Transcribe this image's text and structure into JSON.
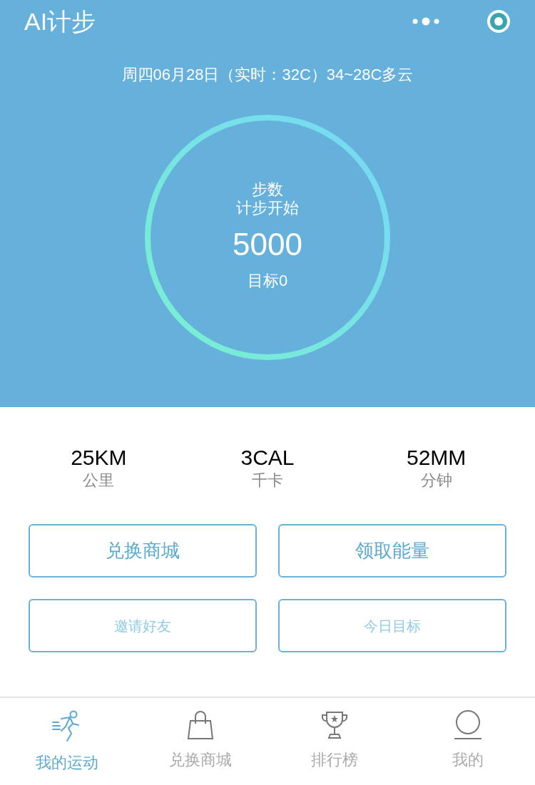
{
  "header": {
    "title": "AI计步",
    "date_weather": "周四06月28日（实时：32C）34~28C多云"
  },
  "ring": {
    "label": "步数",
    "status": "计步开始",
    "steps": "5000",
    "goal": "目标0"
  },
  "stats": [
    {
      "value": "25KM",
      "unit": "公里"
    },
    {
      "value": "3CAL",
      "unit": "千卡"
    },
    {
      "value": "52MM",
      "unit": "分钟"
    }
  ],
  "buttons": [
    {
      "label": "兑换商城",
      "kind": "primary"
    },
    {
      "label": "领取能量",
      "kind": "primary"
    },
    {
      "label": "邀请好友",
      "kind": "secondary"
    },
    {
      "label": "今日目标",
      "kind": "secondary"
    }
  ],
  "tab_bar": [
    {
      "label": "我的运动",
      "kind": "runner",
      "selected": true
    },
    {
      "label": "兑换商城",
      "kind": "bag",
      "selected": false
    },
    {
      "label": "排行榜",
      "kind": "trophy",
      "selected": false
    },
    {
      "label": "我的",
      "kind": "profile",
      "selected": false
    }
  ]
}
